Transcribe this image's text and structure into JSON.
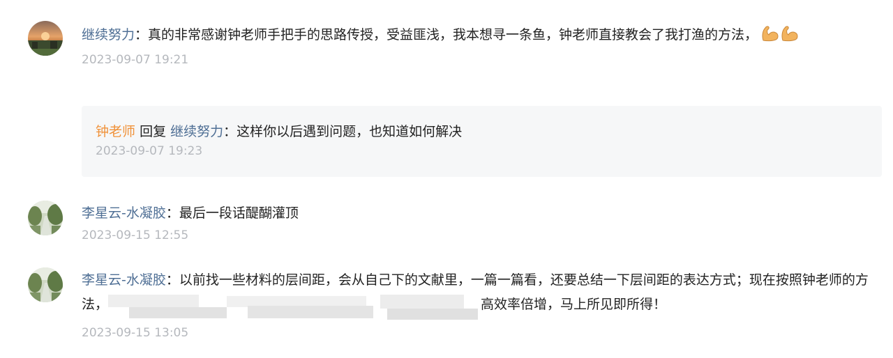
{
  "comments": [
    {
      "user": "继续努力",
      "sep": "：",
      "text": "真的非常感谢钟老师手把手的思路传授，受益匪浅，我本想寻一条鱼，钟老师直接教会了我打渔的方法，",
      "emoji": [
        "flexed-biceps-icon",
        "flexed-biceps-icon"
      ],
      "time": "2023-09-07 19:21",
      "reply": {
        "from": "钟老师",
        "verb": "回复",
        "to": "继续努力",
        "sep": "：",
        "text": "这样你以后遇到问题，也知道如何解决",
        "time": "2023-09-07 19:23"
      }
    },
    {
      "user": "李星云-水凝胶",
      "sep": "：",
      "text": "最后一段话醍醐灌顶",
      "time": "2023-09-15 12:55"
    },
    {
      "user": "李星云-水凝胶",
      "sep": "：",
      "text_before": "以前找一些材料的层间距，会从自己下的文献里，一篇一篇看，还要总结一下层间距的表达方式；现在按照钟老师的方法，",
      "text_after": "高效率倍增，马上所见即所得！",
      "time": "2023-09-15 13:05"
    }
  ],
  "colors": {
    "username": "#4f6f95",
    "teacher": "#f0923a",
    "timestamp": "#b5b8bd",
    "reply_bg": "#f6f7f8"
  }
}
